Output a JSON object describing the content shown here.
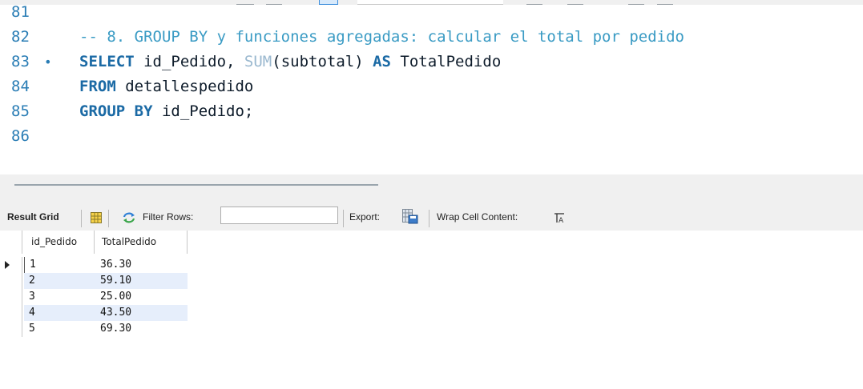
{
  "editor": {
    "lines": [
      {
        "number": "81",
        "marker": "",
        "segments": []
      },
      {
        "number": "82",
        "marker": "",
        "segments": [
          {
            "text": "-- 8. GROUP BY y funciones agregadas: calcular el total por pedido",
            "kind": "comment"
          }
        ]
      },
      {
        "number": "83",
        "marker": "•",
        "segments": [
          {
            "text": "SELECT",
            "kind": "keyword"
          },
          {
            "text": " id_Pedido, ",
            "kind": "text"
          },
          {
            "text": "SUM",
            "kind": "function"
          },
          {
            "text": "(subtotal) ",
            "kind": "text"
          },
          {
            "text": "AS",
            "kind": "keyword"
          },
          {
            "text": " TotalPedido",
            "kind": "text"
          }
        ]
      },
      {
        "number": "84",
        "marker": "",
        "segments": [
          {
            "text": "FROM",
            "kind": "keyword"
          },
          {
            "text": " detallespedido",
            "kind": "text"
          }
        ]
      },
      {
        "number": "85",
        "marker": "",
        "segments": [
          {
            "text": "GROUP BY",
            "kind": "keyword"
          },
          {
            "text": " id_Pedido;",
            "kind": "text"
          }
        ]
      },
      {
        "number": "86",
        "marker": "",
        "segments": []
      }
    ]
  },
  "result_toolbar": {
    "result_grid_label": "Result Grid",
    "filter_rows_label": "Filter Rows:",
    "filter_value": "",
    "export_label": "Export:",
    "wrap_label": "Wrap Cell Content:",
    "grid_icon": "grid-view-icon",
    "refresh_icon": "refresh-icon",
    "export_icon": "export-icon",
    "wrap_icon": "wrap-text-icon"
  },
  "result_grid": {
    "columns": [
      "id_Pedido",
      "TotalPedido"
    ],
    "rows": [
      [
        "1",
        "36.30"
      ],
      [
        "2",
        "59.10"
      ],
      [
        "3",
        "25.00"
      ],
      [
        "4",
        "43.50"
      ],
      [
        "5",
        "69.30"
      ]
    ],
    "current_row": 0
  },
  "colors": {
    "keyword": "#1b6aa5",
    "comment": "#3a9bc4",
    "line_number": "#2a7db5",
    "function": "#9ab8cf",
    "alt_row": "#e6eefb"
  }
}
